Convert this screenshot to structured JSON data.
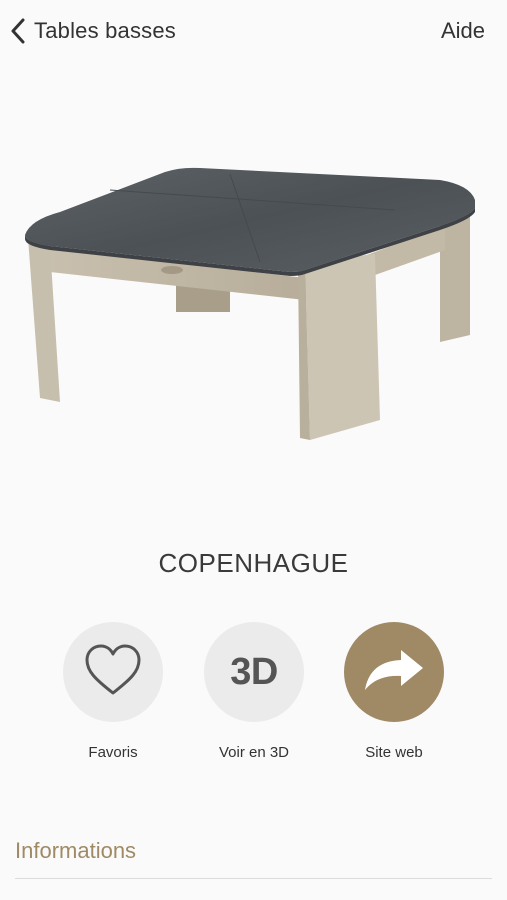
{
  "nav": {
    "back_label": "Tables basses",
    "help_label": "Aide"
  },
  "product": {
    "name": "COPENHAGUE",
    "image_icon": "coffee-table-photo"
  },
  "actions": [
    {
      "label": "Favoris",
      "icon": "heart-icon"
    },
    {
      "label": "Voir en 3D",
      "icon_text": "3D"
    },
    {
      "label": "Site web",
      "icon": "share-arrow-icon"
    }
  ],
  "sections": {
    "informations": "Informations"
  },
  "colors": {
    "accent": "#a08a65",
    "circle_grey": "#ebebeb",
    "text": "#333333"
  }
}
